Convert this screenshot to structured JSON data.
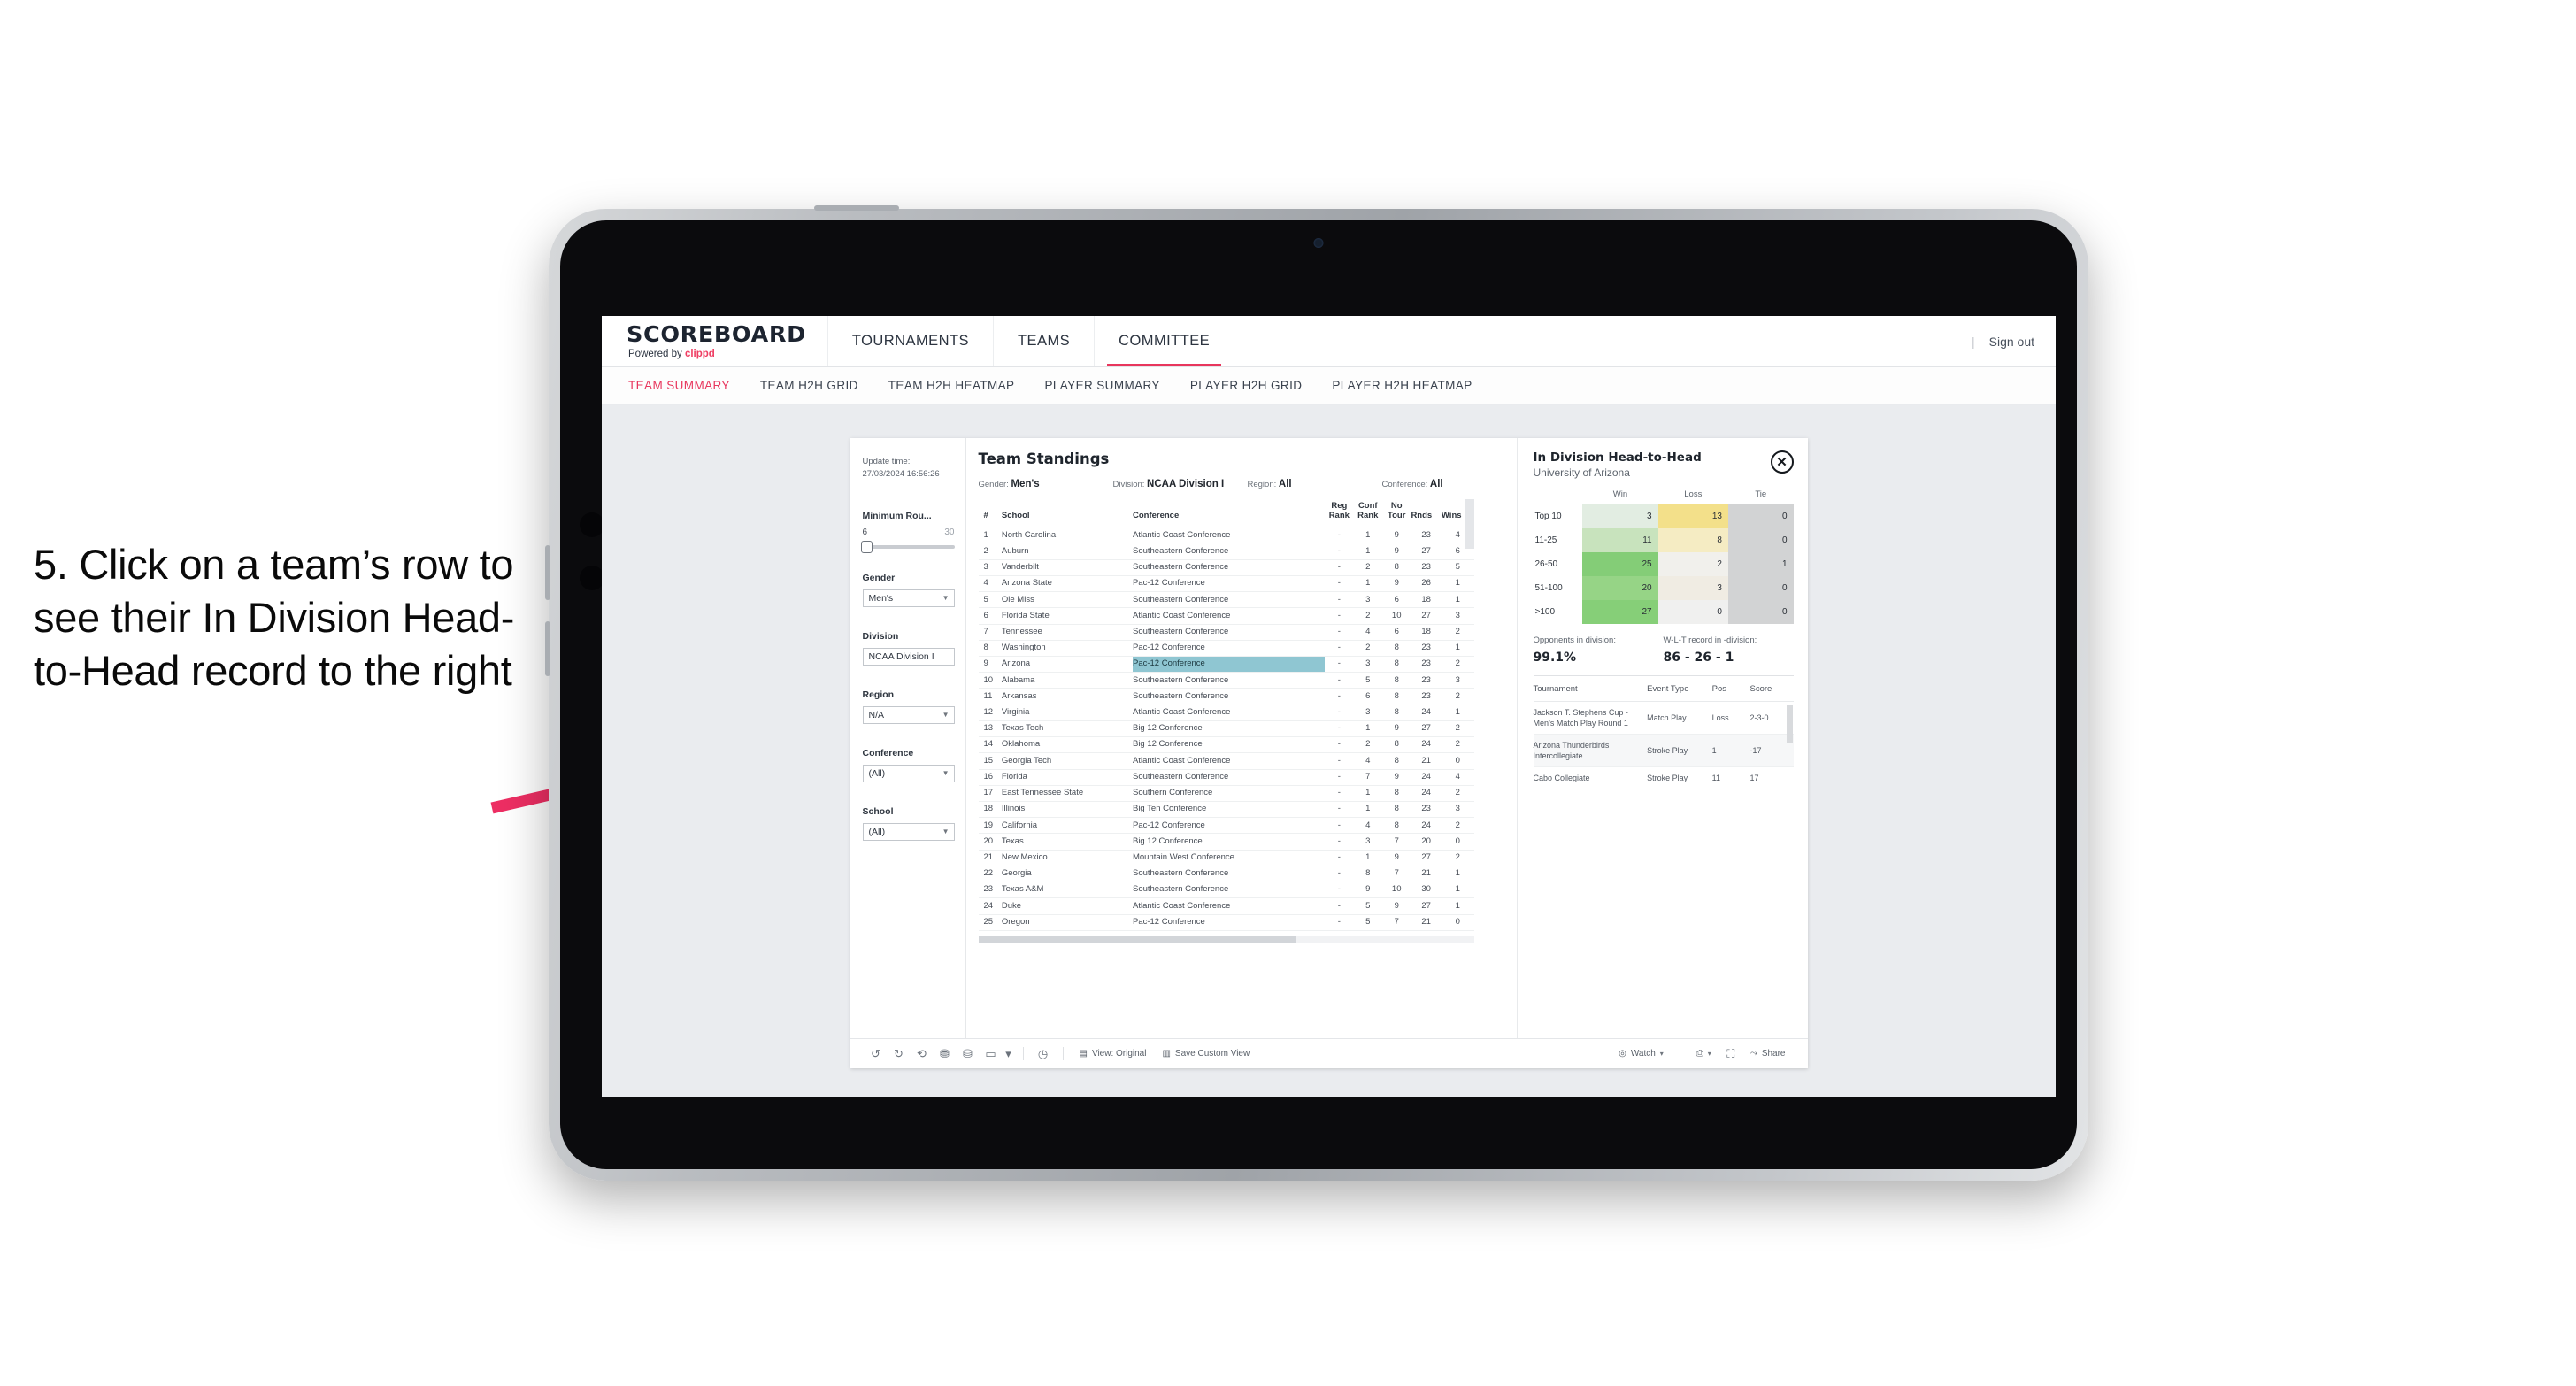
{
  "annotation": {
    "text": "5. Click on a team’s row to see their In Division Head-to-Head record to the right",
    "arrow_color": "#ED2E63"
  },
  "app": {
    "brand": {
      "title": "SCOREBOARD",
      "powered_prefix": "Powered by ",
      "powered_name": "clippd"
    },
    "topnav": [
      {
        "label": "TOURNAMENTS",
        "active": false
      },
      {
        "label": "TEAMS",
        "active": false
      },
      {
        "label": "COMMITTEE",
        "active": true
      }
    ],
    "header_right": {
      "divider": "|",
      "sign_out": "Sign out"
    },
    "subnav": [
      {
        "label": "TEAM SUMMARY",
        "active": true
      },
      {
        "label": "TEAM H2H GRID",
        "active": false
      },
      {
        "label": "TEAM H2H HEATMAP",
        "active": false
      },
      {
        "label": "PLAYER SUMMARY",
        "active": false
      },
      {
        "label": "PLAYER H2H GRID",
        "active": false
      },
      {
        "label": "PLAYER H2H HEATMAP",
        "active": false
      }
    ]
  },
  "filters": {
    "update_time_label": "Update time:",
    "update_time_value": "27/03/2024 16:56:26",
    "slider": {
      "label": "Minimum Rou...",
      "min": "6",
      "max": "30"
    },
    "selects": [
      {
        "label": "Gender",
        "value": "Men's"
      },
      {
        "label": "Division",
        "value": "NCAA Division I"
      },
      {
        "label": "Region",
        "value": "N/A"
      },
      {
        "label": "Conference",
        "value": "(All)"
      },
      {
        "label": "School",
        "value": "(All)"
      }
    ]
  },
  "standings": {
    "title": "Team Standings",
    "meta": [
      {
        "label": "Gender: ",
        "value": "Men's"
      },
      {
        "label": "Division: ",
        "value": "NCAA Division I"
      },
      {
        "label": "Region: ",
        "value": "All"
      },
      {
        "label": "Conference: ",
        "value": "All"
      }
    ],
    "columns": [
      "#",
      "School",
      "Conference",
      "Reg Rank",
      "Conf Rank",
      "No Tour",
      "Rnds",
      "Wins"
    ],
    "selected_row_index": 8,
    "rows": [
      [
        "1",
        "North Carolina",
        "Atlantic Coast Conference",
        "-",
        "1",
        "9",
        "23",
        "4"
      ],
      [
        "2",
        "Auburn",
        "Southeastern Conference",
        "-",
        "1",
        "9",
        "27",
        "6"
      ],
      [
        "3",
        "Vanderbilt",
        "Southeastern Conference",
        "-",
        "2",
        "8",
        "23",
        "5"
      ],
      [
        "4",
        "Arizona State",
        "Pac-12 Conference",
        "-",
        "1",
        "9",
        "26",
        "1"
      ],
      [
        "5",
        "Ole Miss",
        "Southeastern Conference",
        "-",
        "3",
        "6",
        "18",
        "1"
      ],
      [
        "6",
        "Florida State",
        "Atlantic Coast Conference",
        "-",
        "2",
        "10",
        "27",
        "3"
      ],
      [
        "7",
        "Tennessee",
        "Southeastern Conference",
        "-",
        "4",
        "6",
        "18",
        "2"
      ],
      [
        "8",
        "Washington",
        "Pac-12 Conference",
        "-",
        "2",
        "8",
        "23",
        "1"
      ],
      [
        "9",
        "Arizona",
        "Pac-12 Conference",
        "-",
        "3",
        "8",
        "23",
        "2"
      ],
      [
        "10",
        "Alabama",
        "Southeastern Conference",
        "-",
        "5",
        "8",
        "23",
        "3"
      ],
      [
        "11",
        "Arkansas",
        "Southeastern Conference",
        "-",
        "6",
        "8",
        "23",
        "2"
      ],
      [
        "12",
        "Virginia",
        "Atlantic Coast Conference",
        "-",
        "3",
        "8",
        "24",
        "1"
      ],
      [
        "13",
        "Texas Tech",
        "Big 12 Conference",
        "-",
        "1",
        "9",
        "27",
        "2"
      ],
      [
        "14",
        "Oklahoma",
        "Big 12 Conference",
        "-",
        "2",
        "8",
        "24",
        "2"
      ],
      [
        "15",
        "Georgia Tech",
        "Atlantic Coast Conference",
        "-",
        "4",
        "8",
        "21",
        "0"
      ],
      [
        "16",
        "Florida",
        "Southeastern Conference",
        "-",
        "7",
        "9",
        "24",
        "4"
      ],
      [
        "17",
        "East Tennessee State",
        "Southern Conference",
        "-",
        "1",
        "8",
        "24",
        "2"
      ],
      [
        "18",
        "Illinois",
        "Big Ten Conference",
        "-",
        "1",
        "8",
        "23",
        "3"
      ],
      [
        "19",
        "California",
        "Pac-12 Conference",
        "-",
        "4",
        "8",
        "24",
        "2"
      ],
      [
        "20",
        "Texas",
        "Big 12 Conference",
        "-",
        "3",
        "7",
        "20",
        "0"
      ],
      [
        "21",
        "New Mexico",
        "Mountain West Conference",
        "-",
        "1",
        "9",
        "27",
        "2"
      ],
      [
        "22",
        "Georgia",
        "Southeastern Conference",
        "-",
        "8",
        "7",
        "21",
        "1"
      ],
      [
        "23",
        "Texas A&M",
        "Southeastern Conference",
        "-",
        "9",
        "10",
        "30",
        "1"
      ],
      [
        "24",
        "Duke",
        "Atlantic Coast Conference",
        "-",
        "5",
        "9",
        "27",
        "1"
      ],
      [
        "25",
        "Oregon",
        "Pac-12 Conference",
        "-",
        "5",
        "7",
        "21",
        "0"
      ]
    ]
  },
  "h2h": {
    "title": "In Division Head-to-Head",
    "subtitle": "University of Arizona",
    "close_icon": "✕",
    "columns": [
      "Win",
      "Loss",
      "Tie"
    ],
    "row_labels": [
      "Top 10",
      "11-25",
      "26-50",
      "51-100",
      ">100"
    ],
    "matrix": [
      {
        "label": "Top 10",
        "win": "3",
        "loss": "13",
        "tie": "0",
        "win_color": "#e2ede2",
        "loss_color": "#f3e08a",
        "tie_color": "#d2d3d4"
      },
      {
        "label": "11-25",
        "win": "11",
        "loss": "8",
        "tie": "0",
        "win_color": "#c8e3bd",
        "loss_color": "#f5ecc3",
        "tie_color": "#d2d3d4"
      },
      {
        "label": "26-50",
        "win": "25",
        "loss": "2",
        "tie": "1",
        "win_color": "#84cd77",
        "loss_color": "#f1f0ec",
        "tie_color": "#d2d3d4"
      },
      {
        "label": "51-100",
        "win": "20",
        "loss": "3",
        "tie": "0",
        "win_color": "#96d486",
        "loss_color": "#f0ece3",
        "tie_color": "#d2d3d4"
      },
      {
        "label": ">100",
        "win": "27",
        "loss": "0",
        "tie": "0",
        "win_color": "#86cf78",
        "loss_color": "#f0f0ef",
        "tie_color": "#d2d3d4"
      }
    ],
    "stats": [
      {
        "label": "Opponents in division:",
        "value": "99.1%"
      },
      {
        "label": "W-L-T record in -division:",
        "value": "86 - 26 - 1"
      }
    ],
    "tour_columns": [
      "Tournament",
      "Event Type",
      "Pos",
      "Score"
    ],
    "tournaments": [
      {
        "name": "Jackson T. Stephens Cup - Men’s Match Play Round 1",
        "type": "Match Play",
        "pos": "Loss",
        "score": "2-3-0"
      },
      {
        "name": "Arizona Thunderbirds Intercollegiate",
        "type": "Stroke Play",
        "pos": "1",
        "score": "-17"
      },
      {
        "name": "Cabo Collegiate",
        "type": "Stroke Play",
        "pos": "11",
        "score": "17"
      }
    ]
  },
  "toolbar": {
    "view_label": "View: Original",
    "save_label": "Save Custom View",
    "watch_label": "Watch",
    "share_label": "Share"
  }
}
